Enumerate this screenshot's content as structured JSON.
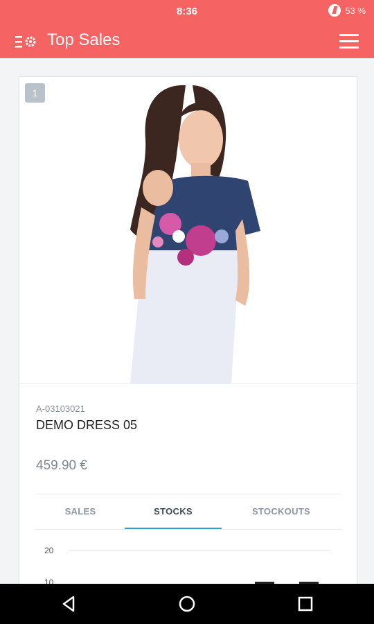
{
  "status_bar": {
    "time": "8:36",
    "battery": "53 %"
  },
  "app_bar": {
    "title": "Top Sales",
    "left_icon": "list-settings-icon",
    "right_icon": "hamburger-menu-icon"
  },
  "product": {
    "rank": "1",
    "sku": "A-03103021",
    "name": "DEMO DRESS 05",
    "price": "459.90 €",
    "image": "product-photo"
  },
  "tabs": [
    {
      "label": "SALES",
      "active": false
    },
    {
      "label": "STOCKS",
      "active": true
    },
    {
      "label": "STOCKOUTS",
      "active": false
    }
  ],
  "chart": {
    "y_ticks": [
      "20",
      "10"
    ]
  },
  "colors": {
    "primary": "#f56363",
    "tab_accent": "#2e9bd6",
    "badge": "#b9c1cb"
  },
  "nav_bar": {
    "buttons": [
      "back-icon",
      "home-icon",
      "recents-icon"
    ]
  }
}
